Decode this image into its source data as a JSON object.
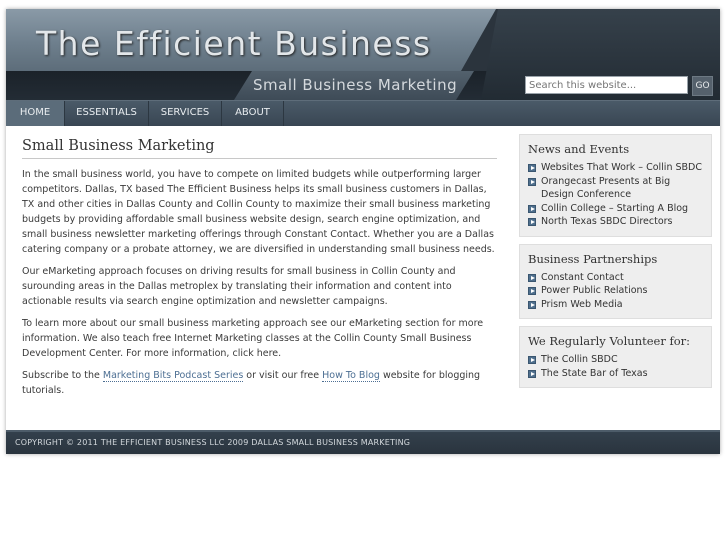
{
  "header": {
    "title": "The Efficient Business",
    "tagline": "Small Business Marketing"
  },
  "search": {
    "placeholder": "Search this website...",
    "button_label": "GO"
  },
  "nav": {
    "items": [
      {
        "label": "HOME",
        "active": true
      },
      {
        "label": "ESSENTIALS"
      },
      {
        "label": "SERVICES"
      },
      {
        "label": "ABOUT"
      }
    ]
  },
  "main": {
    "title": "Small Business Marketing",
    "p1": "In the small business world, you have to compete on limited budgets while outperforming larger competitors.   Dallas, TX based The Efficient Business helps its small business customers in Dallas, TX and other cities in Dallas County and Collin County to maximize their small business marketing budgets by providing affordable small business website design, search engine optimization, and small business newsletter marketing offerings through Constant Contact.  Whether you are a Dallas catering company or a probate attorney, we are diversified in understanding small business needs.",
    "p2": "Our eMarketing approach focuses on driving results for small business in Collin County and surounding areas in the Dallas metroplex by translating their information and content into actionable results via search engine optimization and newsletter campaigns.",
    "p3": "To learn more about our small business marketing approach see our eMarketing section for more information.  We also teach free Internet Marketing classes at the Collin County Small Business Development Center.  For more information, click here.",
    "p4_before": "Subscribe to the ",
    "p4_link1": "Marketing Bits Podcast Series",
    "p4_middle": " or visit our free ",
    "p4_link2": "How To Blog",
    "p4_after": " website for blogging tutorials."
  },
  "sidebar": {
    "news": {
      "title": "News and Events",
      "items": [
        "Websites That Work – Collin SBDC",
        "Orangecast Presents at Big Design Conference",
        "Collin College – Starting A Blog",
        "North Texas SBDC Directors"
      ]
    },
    "partners": {
      "title": "Business Partnerships",
      "items": [
        "Constant Contact",
        "Power Public Relations",
        "Prism Web Media"
      ]
    },
    "volunteer": {
      "title": "We Regularly Volunteer for:",
      "items": [
        "The Collin SBDC",
        "The State Bar of Texas"
      ]
    }
  },
  "footer": {
    "text": "COPYRIGHT © 2011 THE EFFICIENT BUSINESS LLC 2009 DALLAS SMALL BUSINESS MARKETING"
  },
  "colors": {
    "link": "#4d6f93",
    "header_dark": "#2b343d",
    "nav": "#394653",
    "bullet": "#4f6f8d"
  },
  "icons": {
    "bullet": "arrow-bullet-icon"
  }
}
